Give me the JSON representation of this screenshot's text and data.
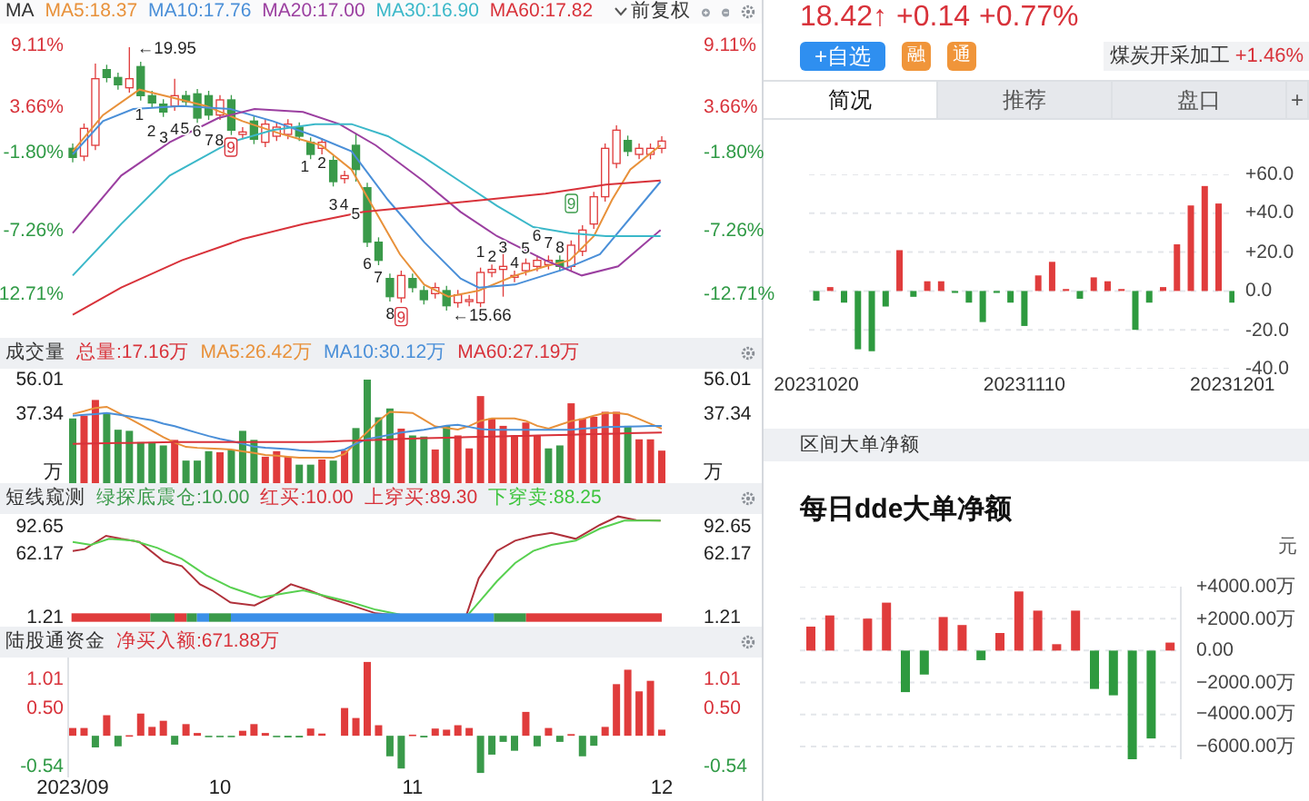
{
  "main_chart": {
    "indicator": "MA",
    "ma_values": [
      {
        "text": "MA5:18.37",
        "color": "#e8913a"
      },
      {
        "text": "MA10:17.76",
        "color": "#4a8fd8"
      },
      {
        "text": "MA20:17.00",
        "color": "#9b3fa0"
      },
      {
        "text": "MA30:16.90",
        "color": "#3bb8c9"
      },
      {
        "text": "MA60:17.82",
        "color": "#d8323a"
      }
    ],
    "adjust": "前复权",
    "left_axis": [
      {
        "text": "9.11%",
        "kind": "up"
      },
      {
        "text": "3.66%",
        "kind": "up"
      },
      {
        "text": "-1.80%",
        "kind": "down"
      },
      {
        "text": "-7.26%",
        "kind": "down"
      },
      {
        "text": "12.71%",
        "kind": "down"
      }
    ],
    "right_axis": [
      {
        "text": "9.11%",
        "kind": "up"
      },
      {
        "text": "3.66%",
        "kind": "up"
      },
      {
        "text": "-1.80%",
        "kind": "down"
      },
      {
        "text": "-7.26%",
        "kind": "down"
      },
      {
        "text": "-12.71%",
        "kind": "down"
      }
    ],
    "annotations": [
      {
        "text": "←19.95",
        "kind": "price"
      },
      {
        "text": "1",
        "kind": "count"
      },
      {
        "text": "2",
        "kind": "count"
      },
      {
        "text": "3",
        "kind": "count"
      },
      {
        "text": "4",
        "kind": "count"
      },
      {
        "text": "5",
        "kind": "count"
      },
      {
        "text": "6",
        "kind": "count"
      },
      {
        "text": "7",
        "kind": "count"
      },
      {
        "text": "8",
        "kind": "count"
      },
      {
        "text": "9",
        "kind": "signal",
        "color": "#d8323a"
      },
      {
        "text": "1",
        "kind": "count"
      },
      {
        "text": "2",
        "kind": "count"
      },
      {
        "text": "3",
        "kind": "count"
      },
      {
        "text": "4",
        "kind": "count"
      },
      {
        "text": "5",
        "kind": "count"
      },
      {
        "text": "6",
        "kind": "count"
      },
      {
        "text": "7",
        "kind": "count"
      },
      {
        "text": "8",
        "kind": "count"
      },
      {
        "text": "9",
        "kind": "signal",
        "color": "#d8323a"
      },
      {
        "text": "1",
        "kind": "count"
      },
      {
        "text": "2",
        "kind": "count"
      },
      {
        "text": "3",
        "kind": "count"
      },
      {
        "text": "4",
        "kind": "count"
      },
      {
        "text": "5",
        "kind": "count"
      },
      {
        "text": "6",
        "kind": "count"
      },
      {
        "text": "7",
        "kind": "count"
      },
      {
        "text": "8",
        "kind": "count"
      },
      {
        "text": "9",
        "kind": "signal",
        "color": "#3a9a4a"
      },
      {
        "text": "←15.66",
        "kind": "price"
      }
    ]
  },
  "volume_panel": {
    "title": "成交量",
    "legend": [
      {
        "text": "总量:17.16万",
        "color": "#d8323a"
      },
      {
        "text": "MA5:26.42万",
        "color": "#e8913a"
      },
      {
        "text": "MA10:30.12万",
        "color": "#4a8fd8"
      },
      {
        "text": "MA60:27.19万",
        "color": "#d8323a"
      }
    ],
    "right_axis": [
      "56.01",
      "37.34"
    ],
    "units": [
      "万",
      "万"
    ],
    "chart_data": {
      "type": "bar",
      "stacked": true,
      "ylim": [
        0,
        56.01
      ],
      "categories": [
        null,
        null,
        null,
        null,
        null,
        null,
        null,
        null,
        null,
        null,
        null,
        null,
        null,
        null,
        null,
        null,
        null,
        null,
        null,
        null,
        null,
        null,
        null,
        null,
        null,
        null,
        null,
        null,
        null,
        null,
        null,
        null,
        null,
        null,
        null,
        null,
        null,
        null,
        null,
        null,
        null,
        null,
        null,
        null,
        null,
        null,
        null,
        null,
        null,
        null,
        null,
        null,
        null
      ],
      "yticks": [
        {
          "value": 56.01,
          "label": "56.01"
        },
        {
          "value": 37.34,
          "label": "37.34"
        }
      ],
      "series": [
        {
          "color": "#e03c3c",
          "values": [
            null,
            36.5,
            45.0,
            null,
            null,
            null,
            null,
            null,
            null,
            23.4,
            null,
            null,
            null,
            16.7,
            null,
            null,
            null,
            14.3,
            17.3,
            14.3,
            null,
            null,
            12.8,
            null,
            17.6,
            null,
            null,
            null,
            null,
            29.5,
            null,
            null,
            18.2,
            null,
            25.8,
            18.8,
            47.1,
            35.0,
            31.0,
            25.8,
            32.8,
            25.8,
            null,
            null,
            43.2,
            35.0,
            35.9,
            38.6,
            38.6,
            null,
            23.7,
            23.7,
            17.6
          ]
        },
        {
          "color": "#3a9a4a",
          "values": [
            35.0,
            null,
            null,
            38.0,
            28.9,
            28.3,
            22.2,
            22.2,
            20.4,
            null,
            12.2,
            12.2,
            17.3,
            null,
            18.2,
            28.3,
            23.4,
            null,
            null,
            null,
            10.0,
            10.0,
            null,
            12.2,
            null,
            29.8,
            56.0,
            35.6,
            40.4,
            null,
            25.8,
            25.2,
            null,
            31.0,
            null,
            null,
            null,
            null,
            null,
            null,
            null,
            null,
            18.8,
            20.4,
            null,
            null,
            null,
            null,
            null,
            31.0,
            null,
            null,
            null
          ]
        },
        {
          "type": "line",
          "color": "#e8913a",
          "values": [
            37.4,
            38.9,
            40.7,
            41.3,
            38.1,
            35.0,
            31.6,
            28.3,
            24.9,
            21.9,
            19.6,
            19.1,
            18.8,
            18.5,
            18.2,
            17.2,
            16.3,
            15.2,
            14.9,
            14.3,
            13.8,
            13.7,
            13.7,
            13.7,
            15.8,
            21.9,
            27.7,
            33.7,
            38.6,
            38.3,
            38.0,
            34.3,
            30.7,
            29.8,
            29.0,
            30.9,
            33.7,
            35.0,
            35.0,
            35.0,
            33.7,
            31.0,
            29.5,
            31.6,
            33.6,
            34.7,
            36.5,
            38.0,
            38.0,
            37.2,
            34.7,
            32.1,
            29.5
          ]
        },
        {
          "type": "line",
          "color": "#4a8fd8",
          "values": [
            36.5,
            37.0,
            37.4,
            37.9,
            37.1,
            36.1,
            35.0,
            34.0,
            32.2,
            30.8,
            29.0,
            27.2,
            25.5,
            24.0,
            22.7,
            21.3,
            19.8,
            19.2,
            18.8,
            18.4,
            17.8,
            17.4,
            17.1,
            16.9,
            18.2,
            21.3,
            23.8,
            25.0,
            26.2,
            27.4,
            28.1,
            28.9,
            30.0,
            31.1,
            31.6,
            30.4,
            29.2,
            28.9,
            28.9,
            28.9,
            28.9,
            28.9,
            28.9,
            28.9,
            28.9,
            29.5,
            29.9,
            30.4,
            30.5,
            30.6,
            30.7,
            30.9,
            31.0
          ]
        },
        {
          "type": "line",
          "color": "#d8323a",
          "values": [
            21.3,
            21.4,
            21.5,
            21.6,
            21.7,
            21.8,
            21.9,
            22.0,
            22.1,
            22.2,
            22.2,
            22.2,
            22.2,
            22.2,
            22.2,
            22.2,
            22.2,
            22.2,
            22.2,
            22.2,
            22.2,
            22.2,
            22.4,
            22.6,
            22.8,
            23.0,
            23.2,
            23.4,
            23.6,
            23.9,
            24.1,
            24.3,
            24.4,
            24.6,
            24.7,
            24.9,
            25.0,
            25.2,
            25.3,
            25.5,
            25.6,
            25.8,
            25.9,
            26.1,
            26.2,
            26.4,
            26.5,
            26.7,
            26.8,
            27.0,
            27.1,
            27.3,
            27.4
          ]
        }
      ]
    }
  },
  "signal_panel": {
    "title": "短线窥测",
    "legend": [
      {
        "text": "绿探底震仓:10.00",
        "color": "#3a9a4a"
      },
      {
        "text": "红买:10.00",
        "color": "#d8323a"
      },
      {
        "text": "上穿买:89.30",
        "color": "#d8323a"
      },
      {
        "text": "下穿卖:88.25",
        "color": "#3cc43c"
      }
    ],
    "left_axis": [
      "92.65",
      "62.17",
      "1.21"
    ],
    "right_axis": [
      "92.65",
      "62.17",
      "1.21"
    ]
  },
  "northbound_panel": {
    "title": "陆股通资金",
    "legend": [
      {
        "text": "净买入额:671.88万",
        "color": "#d8323a"
      }
    ],
    "right_axis": [
      "1.01",
      "0.50",
      "-0.54"
    ],
    "chart_data": {
      "type": "bar",
      "stacked": true,
      "ylim": [
        -0.75,
        1.41
      ],
      "yticks": [
        {
          "value": 1.01,
          "label": "1.01"
        },
        {
          "value": 0.5,
          "label": "0.50"
        },
        {
          "value": -0.54,
          "label": "-0.54"
        }
      ],
      "categories": [
        "2023/09",
        null,
        null,
        null,
        null,
        null,
        null,
        null,
        null,
        null,
        null,
        null,
        null,
        "10",
        null,
        null,
        null,
        null,
        null,
        null,
        null,
        null,
        null,
        null,
        null,
        null,
        null,
        null,
        null,
        null,
        "11",
        null,
        null,
        null,
        null,
        null,
        null,
        null,
        null,
        null,
        null,
        null,
        null,
        null,
        null,
        null,
        null,
        null,
        null,
        null,
        null,
        null,
        "12"
      ],
      "series": [
        {
          "color": "#e03c3c",
          "values": [
            0.14,
            0.14,
            null,
            0.37,
            null,
            0.01,
            0.4,
            0.16,
            0.27,
            null,
            0.21,
            0.05,
            null,
            null,
            null,
            0.09,
            0.21,
            0.05,
            null,
            null,
            null,
            0.13,
            0.04,
            null,
            0.5,
            0.32,
            1.33,
            0.19,
            null,
            null,
            0.02,
            null,
            0.13,
            0.11,
            0.19,
            0.14,
            null,
            null,
            null,
            null,
            0.43,
            null,
            0.14,
            null,
            0.03,
            null,
            null,
            0.16,
            0.93,
            1.19,
            0.8,
            0.99,
            0.11
          ]
        },
        {
          "color": "#3a9a4a",
          "values": [
            null,
            null,
            -0.21,
            null,
            -0.19,
            null,
            null,
            null,
            null,
            -0.16,
            null,
            null,
            -0.02,
            -0.02,
            -0.02,
            null,
            null,
            null,
            -0.02,
            -0.03,
            -0.03,
            null,
            null,
            null,
            null,
            null,
            null,
            null,
            -0.37,
            -0.59,
            null,
            -0.03,
            null,
            null,
            null,
            null,
            -0.67,
            -0.34,
            -0.11,
            -0.27,
            null,
            -0.19,
            null,
            -0.11,
            null,
            -0.37,
            -0.18,
            null,
            null,
            null,
            null,
            null,
            null
          ]
        }
      ]
    }
  },
  "quote": {
    "price": "18.42↑",
    "change": "+0.14",
    "change_pct": "+0.77%"
  },
  "actions": {
    "watchlist_button": "+自选",
    "badges": [
      "融",
      "通"
    ],
    "sector": {
      "name": "煤炭开采加工",
      "change": "+1.46%"
    }
  },
  "tabs": [
    {
      "label": "简况",
      "selected": true
    },
    {
      "label": "推荐",
      "selected": false
    },
    {
      "label": "盘口",
      "selected": false
    },
    {
      "label": "+",
      "selected": false
    }
  ],
  "ratio_chart": {
    "chart_data": {
      "type": "bar",
      "stacked": true,
      "grid": true,
      "ylim": [
        -40,
        60
      ],
      "yticks": [
        {
          "value": 60,
          "label": "+60.0"
        },
        {
          "value": 40,
          "label": "+40.0"
        },
        {
          "value": 20,
          "label": "+20.0"
        },
        {
          "value": 0,
          "label": "0.0"
        },
        {
          "value": -20,
          "label": "-20.0"
        },
        {
          "value": -40,
          "label": "-40.0"
        }
      ],
      "categories": [
        "20231020",
        null,
        null,
        null,
        null,
        null,
        null,
        null,
        null,
        null,
        null,
        null,
        null,
        null,
        null,
        "20231110",
        null,
        null,
        null,
        null,
        null,
        null,
        null,
        null,
        null,
        null,
        null,
        null,
        null,
        null,
        "20231201"
      ],
      "series": [
        {
          "color": "#e03c3c",
          "values": [
            null,
            2,
            null,
            null,
            null,
            null,
            21,
            null,
            5,
            5,
            null,
            null,
            null,
            null,
            null,
            null,
            8,
            15,
            1,
            null,
            7,
            5,
            1,
            null,
            null,
            2,
            24,
            44,
            54,
            45,
            null
          ]
        },
        {
          "color": "#2e9a3f",
          "values": [
            -5,
            null,
            -6,
            -30,
            -31,
            -8,
            null,
            -3,
            null,
            null,
            -1,
            -6,
            -16,
            -1,
            -6,
            -18,
            null,
            null,
            null,
            -4,
            null,
            null,
            null,
            -20,
            -6,
            null,
            null,
            null,
            null,
            null,
            -6
          ]
        }
      ]
    }
  },
  "section_header": "区间大单净额",
  "dde_daily": {
    "title": "每日dde大单净额",
    "unit": "元",
    "chart_data": {
      "type": "bar",
      "stacked": true,
      "grid": true,
      "ylim": [
        -6800,
        4000
      ],
      "yticks": [
        {
          "value": 4000,
          "label": "+4000.00万"
        },
        {
          "value": 2000,
          "label": "+2000.00万"
        },
        {
          "value": 0,
          "label": "0.00"
        },
        {
          "value": -2000,
          "label": "−2000.00万"
        },
        {
          "value": -4000,
          "label": "−4000.00万"
        },
        {
          "value": -6000,
          "label": "−6000.00万"
        }
      ],
      "series": [
        {
          "color": "#e03c3c",
          "values": [
            1500,
            2200,
            null,
            2000,
            3000,
            null,
            null,
            2100,
            1600,
            null,
            1100,
            3700,
            2500,
            400,
            2500,
            null,
            null,
            null,
            null,
            500
          ]
        },
        {
          "color": "#2e9a3f",
          "values": [
            null,
            null,
            null,
            null,
            null,
            -2600,
            -1500,
            null,
            null,
            -600,
            null,
            null,
            null,
            null,
            null,
            -2400,
            -2800,
            -6800,
            -5500,
            null
          ]
        }
      ]
    }
  }
}
